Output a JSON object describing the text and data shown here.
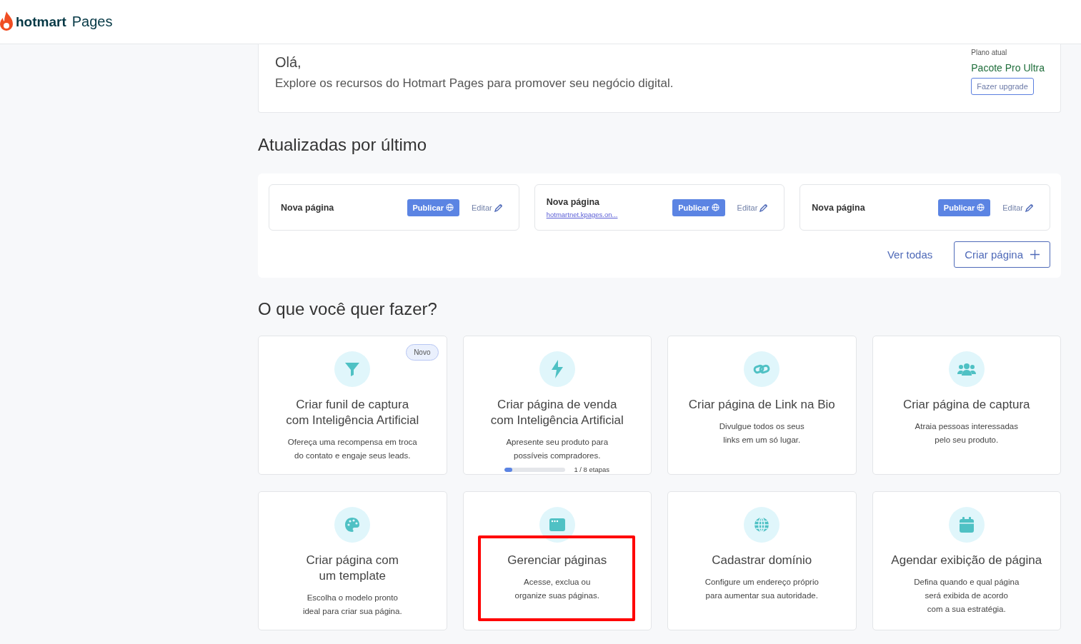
{
  "header": {
    "logo_word": "hotmart",
    "product": "Pages"
  },
  "welcome": {
    "greeting": "Olá,",
    "message": "Explore os recursos do Hotmart Pages para promover seu negócio digital.",
    "plan_label": "Plano atual",
    "plan_name": "Pacote Pro Ultra",
    "upgrade_button": "Fazer upgrade"
  },
  "recent": {
    "title": "Atualizadas por último",
    "pages": [
      {
        "name": "Nova página",
        "publish": "Publicar",
        "edit": "Editar"
      },
      {
        "name": "Nova página",
        "link": "hotmartnet.kpages.on...",
        "publish": "Publicar",
        "edit": "Editar"
      },
      {
        "name": "Nova página",
        "publish": "Publicar",
        "edit": "Editar"
      }
    ],
    "see_all": "Ver todas",
    "create_button": "Criar página"
  },
  "actions": {
    "title": "O que você quer fazer?",
    "cards": [
      {
        "title": "Criar funil de captura com Inteligência Artificial",
        "description": "Ofereça uma recompensa em troca do contato e engaje seus leads.",
        "badge": "Novo",
        "highlighted": false
      },
      {
        "title": "Criar página de venda com Inteligência Artificial",
        "description": "Apresente seu produto para possíveis compradores.",
        "progress": {
          "level": 0.12,
          "label": "1 / 8 etapas"
        },
        "highlighted": false
      },
      {
        "title": "Criar página de Link na Bio",
        "description": "Divulgue todos os seus links em um só lugar.",
        "highlighted": false
      },
      {
        "title": "Criar página de captura",
        "description": "Atraia pessoas interessadas pelo seu produto.",
        "highlighted": false
      },
      {
        "title": "Criar página com um template",
        "description": "Escolha o modelo pronto ideal para criar sua página.",
        "highlighted": false
      },
      {
        "title": "Gerenciar páginas",
        "description": "Acesse, exclua ou organize suas páginas.",
        "highlighted": true
      },
      {
        "title": "Cadastrar domínio",
        "description": "Configure um endereço próprio para aumentar sua autoridade.",
        "highlighted": false
      },
      {
        "title": "Agendar exibição de página",
        "description": "Defina quando e qual página será exibida de acordo com a sua estratégia.",
        "highlighted": false
      }
    ]
  }
}
